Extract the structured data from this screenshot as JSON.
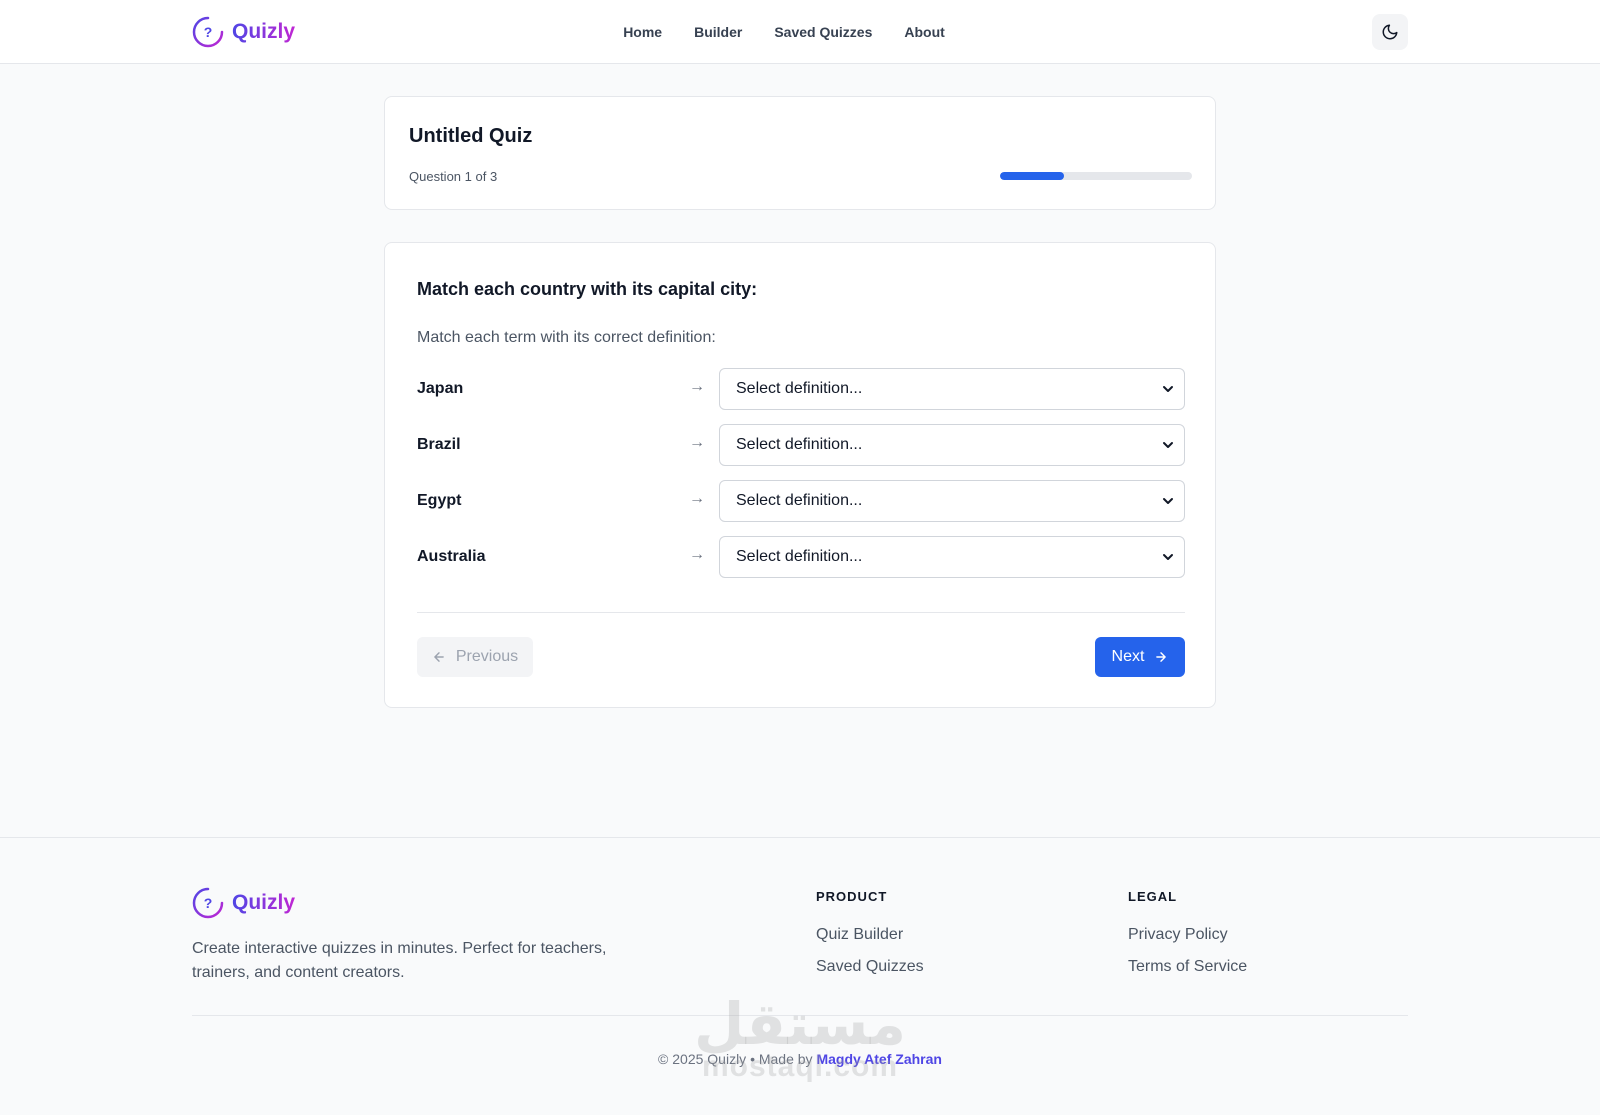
{
  "brand": {
    "name": "Quizly",
    "mark": "?"
  },
  "nav": {
    "items": [
      "Home",
      "Builder",
      "Saved Quizzes",
      "About"
    ]
  },
  "quiz": {
    "title": "Untitled Quiz",
    "progress_label": "Question 1 of 3",
    "progress": {
      "current": 1,
      "total": 3
    }
  },
  "question": {
    "prompt": "Match each country with its capital city:",
    "instructions": "Match each term with its correct definition:",
    "pairs": [
      {
        "term": "Japan",
        "selected": "Select definition..."
      },
      {
        "term": "Brazil",
        "selected": "Select definition..."
      },
      {
        "term": "Egypt",
        "selected": "Select definition..."
      },
      {
        "term": "Australia",
        "selected": "Select definition..."
      }
    ],
    "arrow": "→"
  },
  "buttons": {
    "previous": "Previous",
    "next": "Next"
  },
  "footer": {
    "description": "Create interactive quizzes in minutes. Perfect for teachers, trainers, and content creators.",
    "product": {
      "heading": "PRODUCT",
      "links": [
        "Quiz Builder",
        "Saved Quizzes"
      ]
    },
    "legal": {
      "heading": "LEGAL",
      "links": [
        "Privacy Policy",
        "Terms of Service"
      ]
    },
    "copyright_prefix": "© 2025 Quizly • Made by",
    "author": "Magdy Atef Zahran"
  },
  "watermark": {
    "arabic": "مستقل",
    "latin": "mostaql.com"
  },
  "colors": {
    "accent": "#2563eb",
    "brand_start": "#4f46e5",
    "brand_end": "#c026d3"
  },
  "icons": {
    "theme_toggle": "moon-icon",
    "previous": "arrow-left-icon",
    "next": "arrow-right-icon",
    "select": "chevron-down-icon"
  }
}
